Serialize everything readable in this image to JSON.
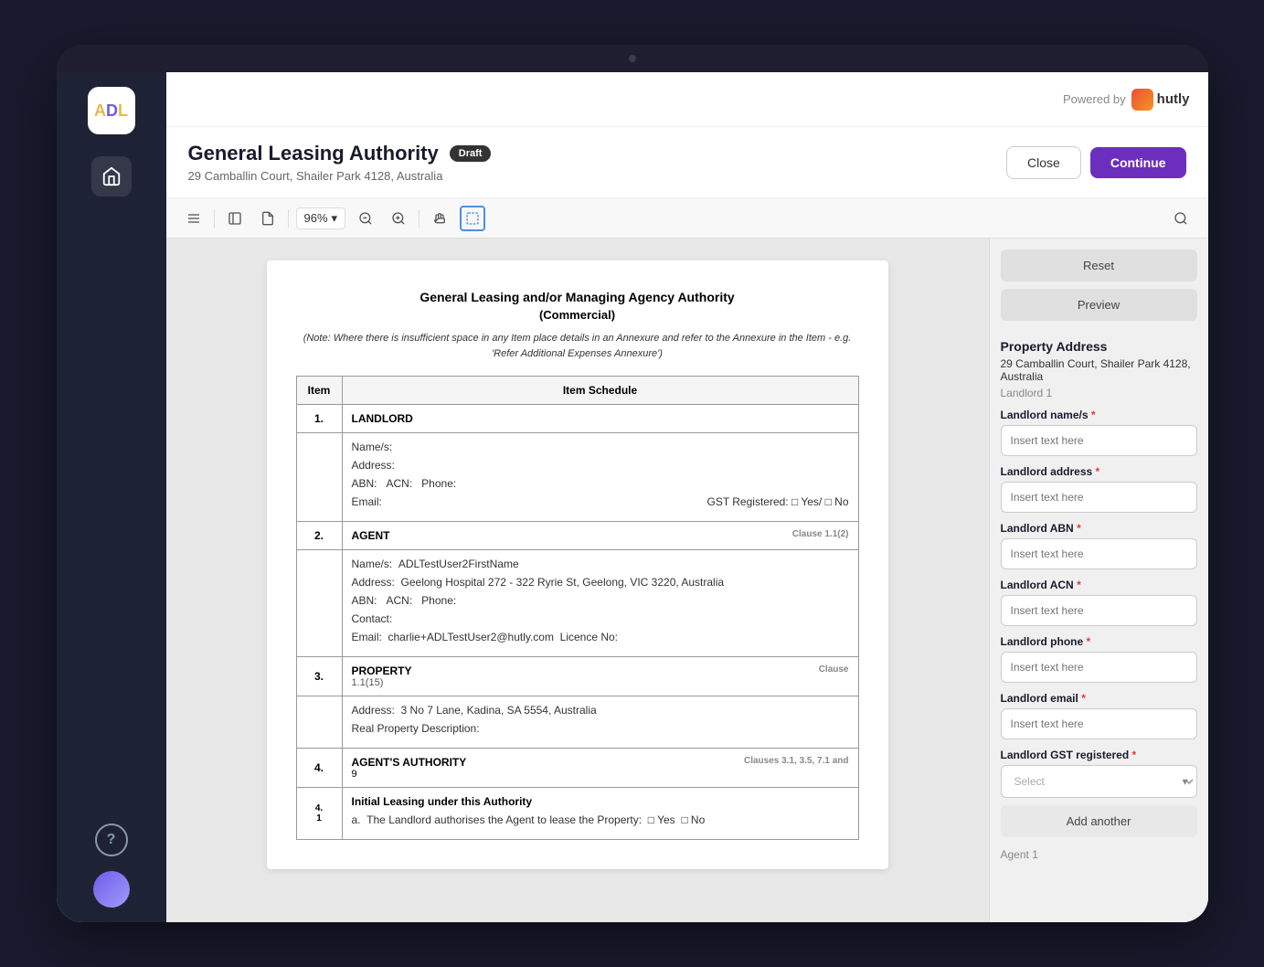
{
  "app": {
    "name": "ADL",
    "logo_letters": "ADL"
  },
  "top_bar": {
    "powered_by": "Powered by",
    "brand": "hutly"
  },
  "header": {
    "title": "General Leasing Authority",
    "badge": "Draft",
    "subtitle": "29 Camballin Court, Shailer Park 4128, Australia",
    "close_btn": "Close",
    "continue_btn": "Continue"
  },
  "toolbar": {
    "zoom_level": "96%",
    "icons": [
      "menu",
      "panel",
      "file",
      "zoom-out",
      "zoom-in",
      "hand",
      "selection",
      "search"
    ]
  },
  "document": {
    "main_title": "General Leasing and/or Managing Agency Authority",
    "subtitle": "(Commercial)",
    "note": "(Note: Where there is insufficient space in any Item place details in an Annexure and refer to the Annexure in the Item - e.g. 'Refer Additional Expenses Annexure')",
    "col_item": "Item",
    "col_schedule": "Item Schedule",
    "sections": [
      {
        "num": "1.",
        "title": "LANDLORD",
        "clause": "",
        "fields": [
          "Name/s:",
          "Address:",
          "ABN:   ACN:   Phone:",
          "Email:"
        ],
        "gst_line": "GST Registered: □ Yes/ □ No"
      },
      {
        "num": "2.",
        "title": "AGENT",
        "clause": "Clause 1.1(2)",
        "fields": [
          "Name/s:  ADLTestUser2FirstName",
          "Address:  Geelong Hospital 272 - 322 Ryrie St, Geelong, VIC 3220, Australia",
          "ABN:   ACN:   Phone:",
          "Contact:",
          "Email:   charlie+ADLTestUser2@hutly.com   Licence No:"
        ]
      },
      {
        "num": "3.",
        "title": "PROPERTY",
        "clause": "Clause",
        "sub_clause": "1.1(15)",
        "fields": [
          "Address:  3 No 7 Lane, Kadina, SA 5554, Australia",
          "Real Property Description:"
        ]
      },
      {
        "num": "4.",
        "title": "AGENT'S AUTHORITY",
        "clause": "Clauses 3.1, 3.5, 7.1 and",
        "sub": "9"
      },
      {
        "num": "4.\n1",
        "title": "Initial Leasing under this Authority",
        "fields": [
          "a.  The Landlord authorises the Agent to lease the Property:  □ Yes  □ No"
        ]
      }
    ]
  },
  "right_panel": {
    "reset_btn": "Reset",
    "preview_btn": "Preview",
    "section_title": "Property Address",
    "prop_address": "29 Camballin Court, Shailer Park 4128, Australia",
    "landlord_subsection": "Landlord 1",
    "fields": [
      {
        "label": "Landlord name/s",
        "required": true,
        "placeholder": "Insert text here",
        "type": "text",
        "id": "landlord-name"
      },
      {
        "label": "Landlord address",
        "required": true,
        "placeholder": "Insert text here",
        "type": "text",
        "id": "landlord-address"
      },
      {
        "label": "Landlord ABN",
        "required": true,
        "placeholder": "Insert text here",
        "type": "text",
        "id": "landlord-abn"
      },
      {
        "label": "Landlord ACN",
        "required": true,
        "placeholder": "Insert text here",
        "type": "text",
        "id": "landlord-acn"
      },
      {
        "label": "Landlord phone",
        "required": true,
        "placeholder": "Insert text here",
        "type": "text",
        "id": "landlord-phone"
      },
      {
        "label": "Landlord email",
        "required": true,
        "placeholder": "Insert text here",
        "type": "text",
        "id": "landlord-email"
      },
      {
        "label": "Landlord GST registered",
        "required": true,
        "placeholder": "Select",
        "type": "select",
        "id": "landlord-gst"
      }
    ],
    "add_another_btn": "Add another",
    "next_section": "Agent 1"
  }
}
